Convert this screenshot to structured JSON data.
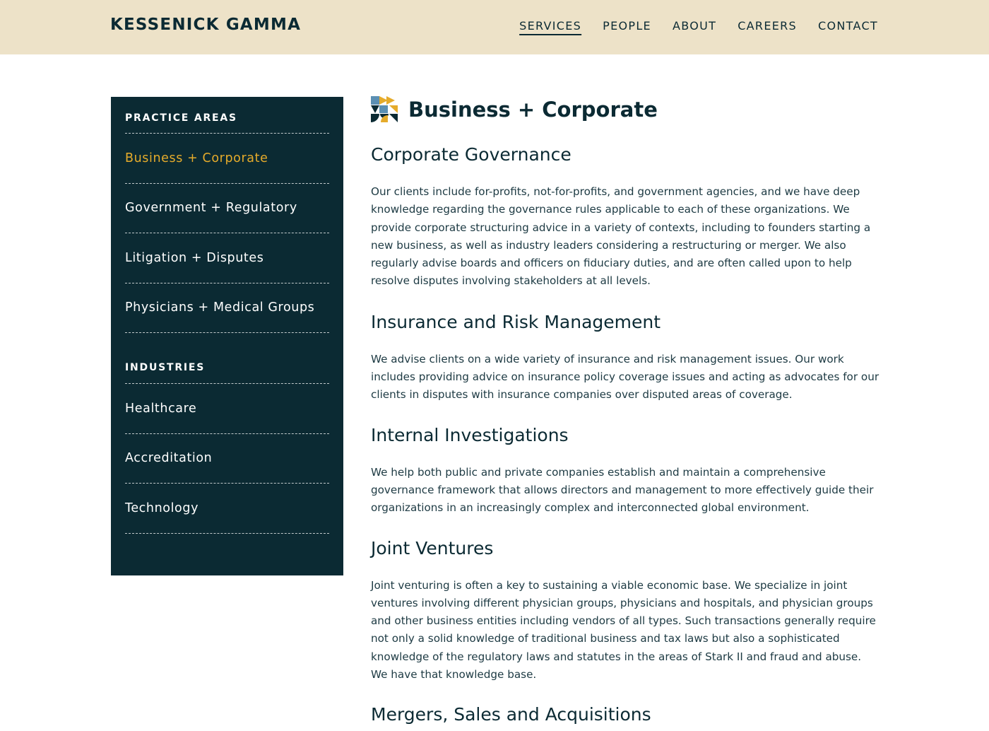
{
  "header": {
    "logo": "KESSENICK GAMMA",
    "nav": [
      {
        "label": "SERVICES",
        "active": true
      },
      {
        "label": "PEOPLE"
      },
      {
        "label": "ABOUT"
      },
      {
        "label": "CAREERS"
      },
      {
        "label": "CONTACT"
      }
    ]
  },
  "sidebar": {
    "practice_heading": "PRACTICE AREAS",
    "practice_items": [
      "Business + Corporate",
      "Government + Regulatory",
      "Litigation + Disputes",
      "Physicians + Medical Groups"
    ],
    "industries_heading": "INDUSTRIES",
    "industry_items": [
      "Healthcare",
      "Accreditation",
      "Technology"
    ]
  },
  "main": {
    "icon": "geometric-brand-icon",
    "title": "Business + Corporate",
    "sections": [
      {
        "heading": "Corporate Governance",
        "body": "Our clients include for-profits, not-for-profits, and government agencies, and we have deep knowledge regarding the governance rules applicable to each of these organizations.  We provide corporate structuring advice in a variety of contexts, including to founders starting a new business, as well as industry leaders considering a restructuring or merger.  We also regularly advise boards and officers on fiduciary duties, and are often called upon to help resolve disputes involving stakeholders at all levels."
      },
      {
        "heading": "Insurance and Risk Management",
        "body": "We advise clients on a wide variety of insurance and risk management issues. Our work includes providing advice on insurance policy coverage issues and acting as advocates for our clients in disputes with insurance companies over disputed areas of coverage."
      },
      {
        "heading": "Internal Investigations",
        "body": "We help both public and private companies establish and maintain a comprehensive governance framework that allows directors and management to more effectively guide their organizations in an increasingly complex and interconnected global environment."
      },
      {
        "heading": "Joint Ventures",
        "body": "Joint venturing is often a key to sustaining a viable economic base. We specialize in joint ventures involving different physician groups, physicians and hospitals, and physician groups and other business entities including vendors of all types. Such transactions generally require not only a solid knowledge of traditional business and tax laws but also a sophisticated knowledge of the regulatory laws and statutes in the areas of Stark II and fraud and abuse. We have that knowledge base."
      },
      {
        "heading": "Mergers, Sales and Acquisitions",
        "body": ""
      }
    ]
  },
  "colors": {
    "header_bg": "#ede2c8",
    "sidebar_bg": "#0b2a33",
    "accent": "#e5ab2b",
    "text": "#0b2a33"
  }
}
